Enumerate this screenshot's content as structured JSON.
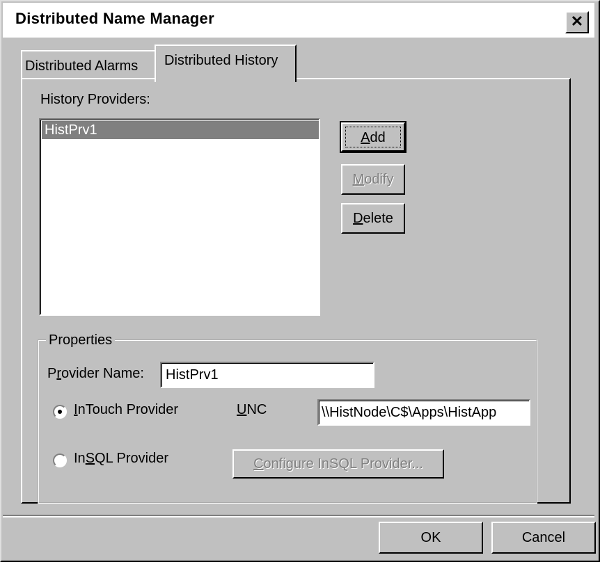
{
  "window": {
    "title": "Distributed Name Manager",
    "close_glyph": "✕"
  },
  "tabs": [
    {
      "label": "Distributed Alarms",
      "selected": false
    },
    {
      "label": "Distributed History",
      "selected": true
    }
  ],
  "history_providers": {
    "label": "History Providers:",
    "items": [
      "HistPrv1"
    ],
    "selected": "HistPrv1"
  },
  "buttons": {
    "add": {
      "label": "Add",
      "mnemonic": "A",
      "rest": "dd"
    },
    "modify": {
      "label": "Modify",
      "mnemonic": "M",
      "rest": "odify",
      "enabled": false
    },
    "delete": {
      "label": "Delete",
      "mnemonic": "D",
      "rest": "elete"
    },
    "ok": "OK",
    "cancel": "Cancel"
  },
  "properties": {
    "group_label": "Properties",
    "provider_name_label": {
      "pre": "P",
      "mnemonic": "r",
      "post": "ovider Name:"
    },
    "provider_name_value": "HistPrv1",
    "intouch_provider": {
      "pre": "",
      "mnemonic": "I",
      "post": "nTouch Provider",
      "checked": true
    },
    "unc_label": {
      "mnemonic": "U",
      "post": "NC"
    },
    "unc_value": "\\\\HistNode\\C$\\Apps\\HistApp",
    "insql_provider": {
      "pre": "In",
      "mnemonic": "S",
      "post": "QL Provider",
      "checked": false
    },
    "configure_insql": {
      "mnemonic": "C",
      "post": "onfigure InSQL Provider...",
      "enabled": false
    }
  },
  "colors": {
    "face": "#c0c0c0",
    "selection": "#808080",
    "disabled_text": "#808080"
  }
}
